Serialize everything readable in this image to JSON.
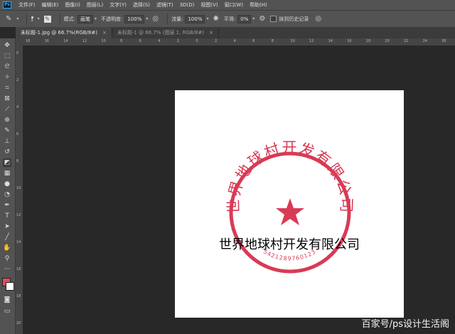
{
  "app": {
    "logo": "Ps"
  },
  "menu": [
    "文件(F)",
    "编辑(E)",
    "图像(I)",
    "图层(L)",
    "文字(Y)",
    "选择(S)",
    "滤镜(T)",
    "3D(D)",
    "视图(V)",
    "窗口(W)",
    "帮助(H)"
  ],
  "options": {
    "brush_size": "3",
    "mode_label": "模式:",
    "mode_value": "画笔",
    "opacity_label": "不透明度:",
    "opacity_value": "100%",
    "flow_label": "流量:",
    "flow_value": "100%",
    "smooth_label": "平滑:",
    "smooth_value": "0%",
    "erase_history_label": "抹到历史记录"
  },
  "tabs": [
    {
      "label": "未标题-1.jpg @ 66.7%(RGB/8#)",
      "close": "×"
    },
    {
      "label": "未标题-1 @ 66.7% (图层 1, RGB/8#)",
      "close": "×"
    }
  ],
  "ruler": {
    "top": [
      "18",
      "16",
      "14",
      "12",
      "10",
      "8",
      "6",
      "4",
      "2",
      "0",
      "2",
      "4",
      "6",
      "8",
      "10",
      "12",
      "14",
      "16",
      "18",
      "20",
      "22",
      "24",
      "26"
    ],
    "left": [
      "0",
      "2",
      "4",
      "6",
      "8",
      "10",
      "12",
      "14",
      "16",
      "18",
      "20"
    ]
  },
  "canvas": {
    "seal_top_text": "世界地球村开发有限公司",
    "seal_bottom_digits": "5421289760123",
    "seal_color": "#d93a55",
    "overlay_text": "世界地球村开发有限公司"
  },
  "colors": {
    "foreground": "#e8495d",
    "background": "#ffffff"
  },
  "watermark": "百家号/ps设计生活阁"
}
